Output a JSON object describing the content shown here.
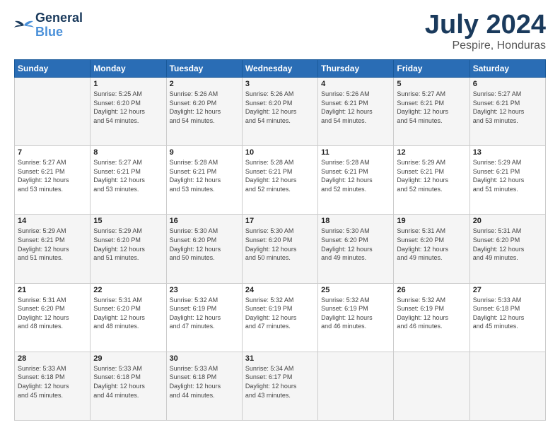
{
  "header": {
    "logo_line1": "General",
    "logo_line2": "Blue",
    "month": "July 2024",
    "location": "Pespire, Honduras"
  },
  "days_of_week": [
    "Sunday",
    "Monday",
    "Tuesday",
    "Wednesday",
    "Thursday",
    "Friday",
    "Saturday"
  ],
  "weeks": [
    [
      {
        "day": "",
        "info": ""
      },
      {
        "day": "1",
        "info": "Sunrise: 5:25 AM\nSunset: 6:20 PM\nDaylight: 12 hours\nand 54 minutes."
      },
      {
        "day": "2",
        "info": "Sunrise: 5:26 AM\nSunset: 6:20 PM\nDaylight: 12 hours\nand 54 minutes."
      },
      {
        "day": "3",
        "info": "Sunrise: 5:26 AM\nSunset: 6:20 PM\nDaylight: 12 hours\nand 54 minutes."
      },
      {
        "day": "4",
        "info": "Sunrise: 5:26 AM\nSunset: 6:21 PM\nDaylight: 12 hours\nand 54 minutes."
      },
      {
        "day": "5",
        "info": "Sunrise: 5:27 AM\nSunset: 6:21 PM\nDaylight: 12 hours\nand 54 minutes."
      },
      {
        "day": "6",
        "info": "Sunrise: 5:27 AM\nSunset: 6:21 PM\nDaylight: 12 hours\nand 53 minutes."
      }
    ],
    [
      {
        "day": "7",
        "info": "Sunrise: 5:27 AM\nSunset: 6:21 PM\nDaylight: 12 hours\nand 53 minutes."
      },
      {
        "day": "8",
        "info": "Sunrise: 5:27 AM\nSunset: 6:21 PM\nDaylight: 12 hours\nand 53 minutes."
      },
      {
        "day": "9",
        "info": "Sunrise: 5:28 AM\nSunset: 6:21 PM\nDaylight: 12 hours\nand 53 minutes."
      },
      {
        "day": "10",
        "info": "Sunrise: 5:28 AM\nSunset: 6:21 PM\nDaylight: 12 hours\nand 52 minutes."
      },
      {
        "day": "11",
        "info": "Sunrise: 5:28 AM\nSunset: 6:21 PM\nDaylight: 12 hours\nand 52 minutes."
      },
      {
        "day": "12",
        "info": "Sunrise: 5:29 AM\nSunset: 6:21 PM\nDaylight: 12 hours\nand 52 minutes."
      },
      {
        "day": "13",
        "info": "Sunrise: 5:29 AM\nSunset: 6:21 PM\nDaylight: 12 hours\nand 51 minutes."
      }
    ],
    [
      {
        "day": "14",
        "info": "Sunrise: 5:29 AM\nSunset: 6:21 PM\nDaylight: 12 hours\nand 51 minutes."
      },
      {
        "day": "15",
        "info": "Sunrise: 5:29 AM\nSunset: 6:20 PM\nDaylight: 12 hours\nand 51 minutes."
      },
      {
        "day": "16",
        "info": "Sunrise: 5:30 AM\nSunset: 6:20 PM\nDaylight: 12 hours\nand 50 minutes."
      },
      {
        "day": "17",
        "info": "Sunrise: 5:30 AM\nSunset: 6:20 PM\nDaylight: 12 hours\nand 50 minutes."
      },
      {
        "day": "18",
        "info": "Sunrise: 5:30 AM\nSunset: 6:20 PM\nDaylight: 12 hours\nand 49 minutes."
      },
      {
        "day": "19",
        "info": "Sunrise: 5:31 AM\nSunset: 6:20 PM\nDaylight: 12 hours\nand 49 minutes."
      },
      {
        "day": "20",
        "info": "Sunrise: 5:31 AM\nSunset: 6:20 PM\nDaylight: 12 hours\nand 49 minutes."
      }
    ],
    [
      {
        "day": "21",
        "info": "Sunrise: 5:31 AM\nSunset: 6:20 PM\nDaylight: 12 hours\nand 48 minutes."
      },
      {
        "day": "22",
        "info": "Sunrise: 5:31 AM\nSunset: 6:20 PM\nDaylight: 12 hours\nand 48 minutes."
      },
      {
        "day": "23",
        "info": "Sunrise: 5:32 AM\nSunset: 6:19 PM\nDaylight: 12 hours\nand 47 minutes."
      },
      {
        "day": "24",
        "info": "Sunrise: 5:32 AM\nSunset: 6:19 PM\nDaylight: 12 hours\nand 47 minutes."
      },
      {
        "day": "25",
        "info": "Sunrise: 5:32 AM\nSunset: 6:19 PM\nDaylight: 12 hours\nand 46 minutes."
      },
      {
        "day": "26",
        "info": "Sunrise: 5:32 AM\nSunset: 6:19 PM\nDaylight: 12 hours\nand 46 minutes."
      },
      {
        "day": "27",
        "info": "Sunrise: 5:33 AM\nSunset: 6:18 PM\nDaylight: 12 hours\nand 45 minutes."
      }
    ],
    [
      {
        "day": "28",
        "info": "Sunrise: 5:33 AM\nSunset: 6:18 PM\nDaylight: 12 hours\nand 45 minutes."
      },
      {
        "day": "29",
        "info": "Sunrise: 5:33 AM\nSunset: 6:18 PM\nDaylight: 12 hours\nand 44 minutes."
      },
      {
        "day": "30",
        "info": "Sunrise: 5:33 AM\nSunset: 6:18 PM\nDaylight: 12 hours\nand 44 minutes."
      },
      {
        "day": "31",
        "info": "Sunrise: 5:34 AM\nSunset: 6:17 PM\nDaylight: 12 hours\nand 43 minutes."
      },
      {
        "day": "",
        "info": ""
      },
      {
        "day": "",
        "info": ""
      },
      {
        "day": "",
        "info": ""
      }
    ]
  ]
}
